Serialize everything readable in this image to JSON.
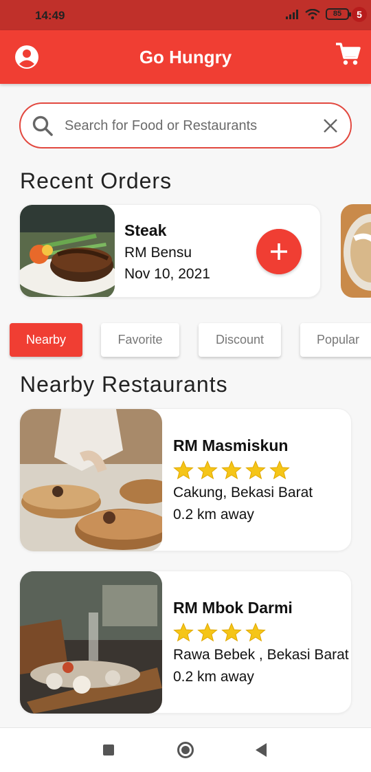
{
  "status_bar": {
    "time": "14:49",
    "battery": "85"
  },
  "app_bar": {
    "title": "Go Hungry",
    "cart_count": "5"
  },
  "search": {
    "placeholder": "Search for Food or Restaurants",
    "value": ""
  },
  "recent_orders": {
    "title": "Recent Orders",
    "items": [
      {
        "name": "Steak",
        "restaurant": "RM Bensu",
        "date": "Nov 10, 2021"
      }
    ]
  },
  "filters": {
    "chips": [
      {
        "label": "Nearby",
        "active": true
      },
      {
        "label": "Favorite",
        "active": false
      },
      {
        "label": "Discount",
        "active": false
      },
      {
        "label": "Popular",
        "active": false
      }
    ]
  },
  "nearby": {
    "title": "Nearby Restaurants",
    "restaurants": [
      {
        "name": "RM Masmiskun",
        "rating": 5,
        "location": "Cakung, Bekasi Barat",
        "distance": "0.2 km away"
      },
      {
        "name": "RM Mbok Darmi",
        "rating": 4,
        "location": "Rawa Bebek , Bekasi Barat",
        "distance": "0.2 km away"
      }
    ]
  },
  "colors": {
    "primary": "#f03e33",
    "status_bar": "#c0302a",
    "star": "#f5c518"
  },
  "icons": [
    "account-circle-icon",
    "cart-icon",
    "search-icon",
    "close-icon",
    "add-icon",
    "star-icon",
    "nav-recents-icon",
    "nav-home-icon",
    "nav-back-icon"
  ]
}
